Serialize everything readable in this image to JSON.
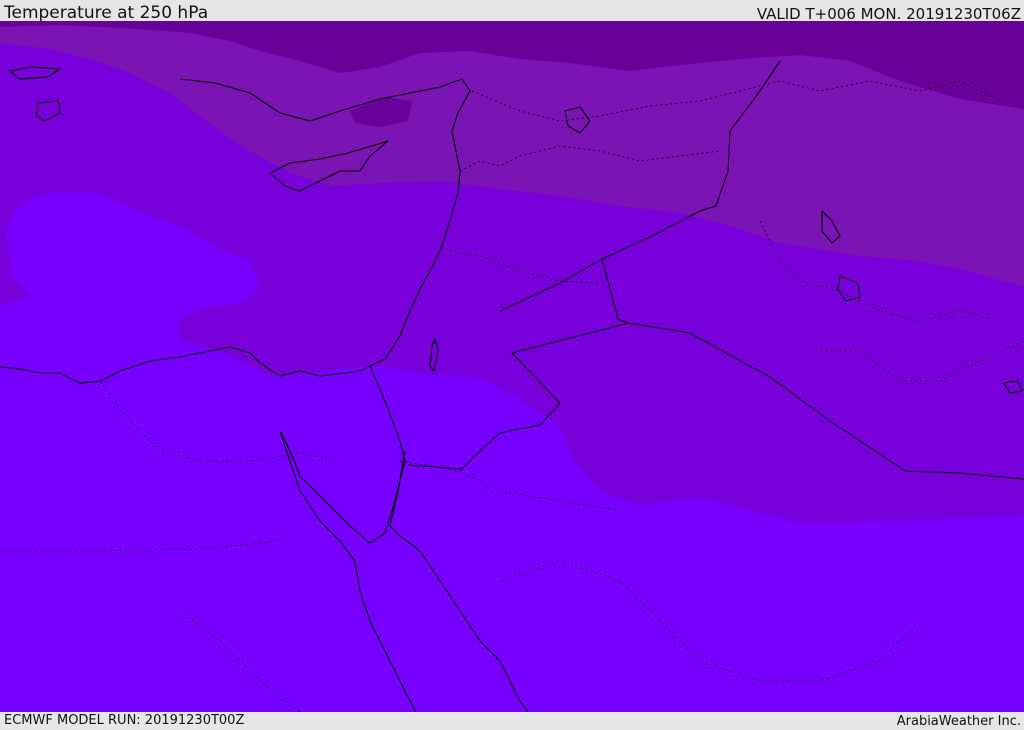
{
  "header": {
    "title": "Temperature at 250 hPa",
    "valid": "VALID T+006 MON. 20191230T06Z"
  },
  "footer": {
    "model_run": "ECMWF MODEL RUN: 20191230T00Z",
    "credit": "ArabiaWeather Inc."
  },
  "map": {
    "field": "temperature",
    "level": "250 hPa",
    "colors": {
      "band_cold_2": "#6a009a",
      "band_cold_1": "#7a14b4",
      "band_mid": "#7800da",
      "band_warm": "#7800ff",
      "coast": "#000000"
    }
  }
}
